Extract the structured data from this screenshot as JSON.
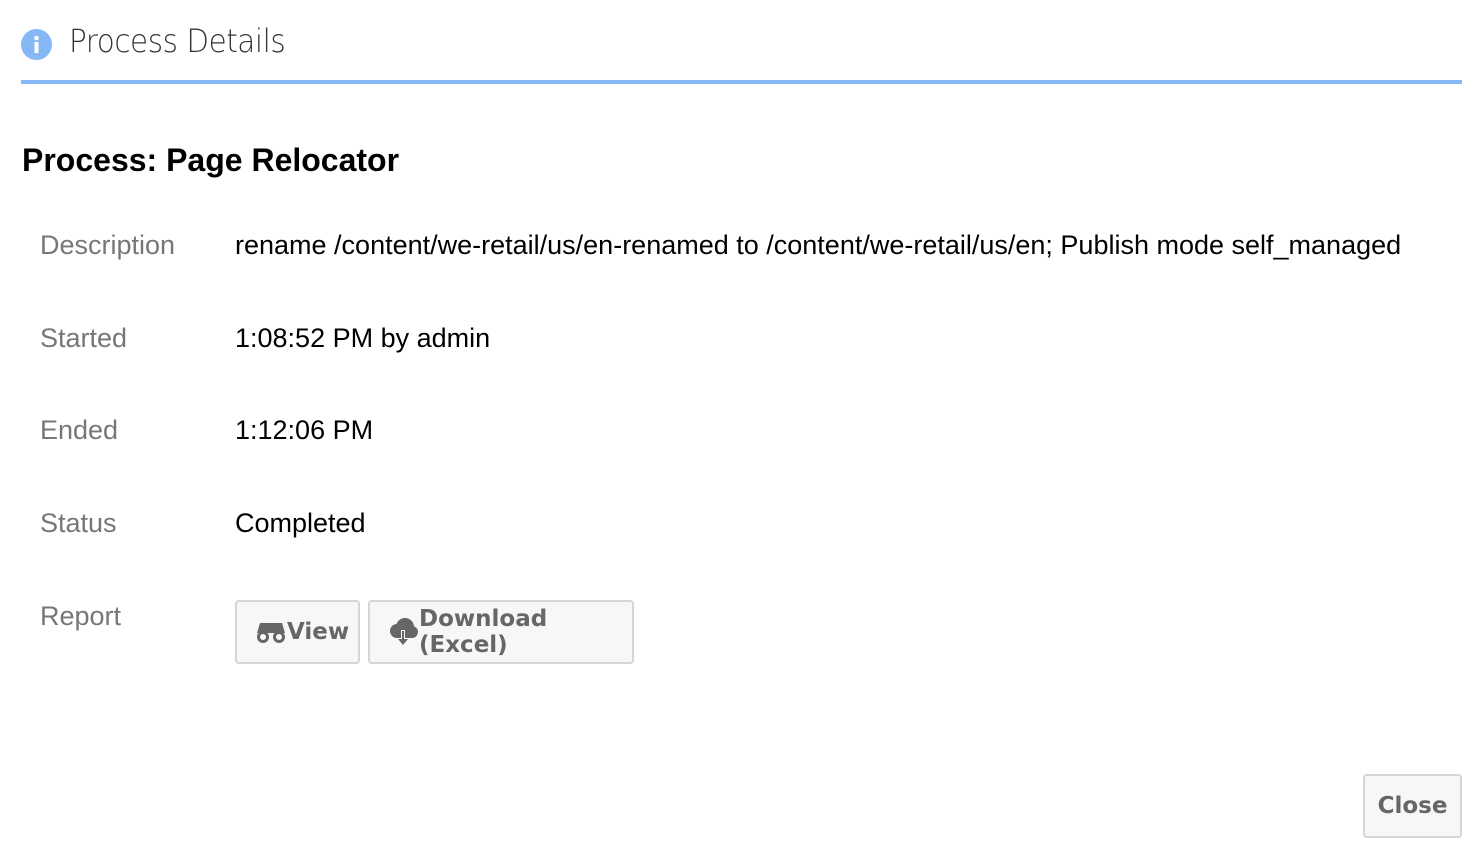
{
  "dialog": {
    "title": "Process Details",
    "icon": "info-icon",
    "accent": "#85b8f5"
  },
  "process_title": "Process: Page Relocator",
  "fields": [
    {
      "label": "Description",
      "value": "rename /content/we-retail/us/en-renamed to /content/we-retail/us/en; Publish mode self_managed"
    },
    {
      "label": "Started",
      "value": "1:08:52 PM by admin"
    },
    {
      "label": "Ended",
      "value": "1:12:06 PM"
    },
    {
      "label": "Status",
      "value": "Completed"
    }
  ],
  "report": {
    "label": "Report",
    "view_label": "View",
    "view_icon": "binoculars-icon",
    "download_label": "Download (Excel)",
    "download_icon": "cloud-download-icon"
  },
  "close_label": "Close"
}
